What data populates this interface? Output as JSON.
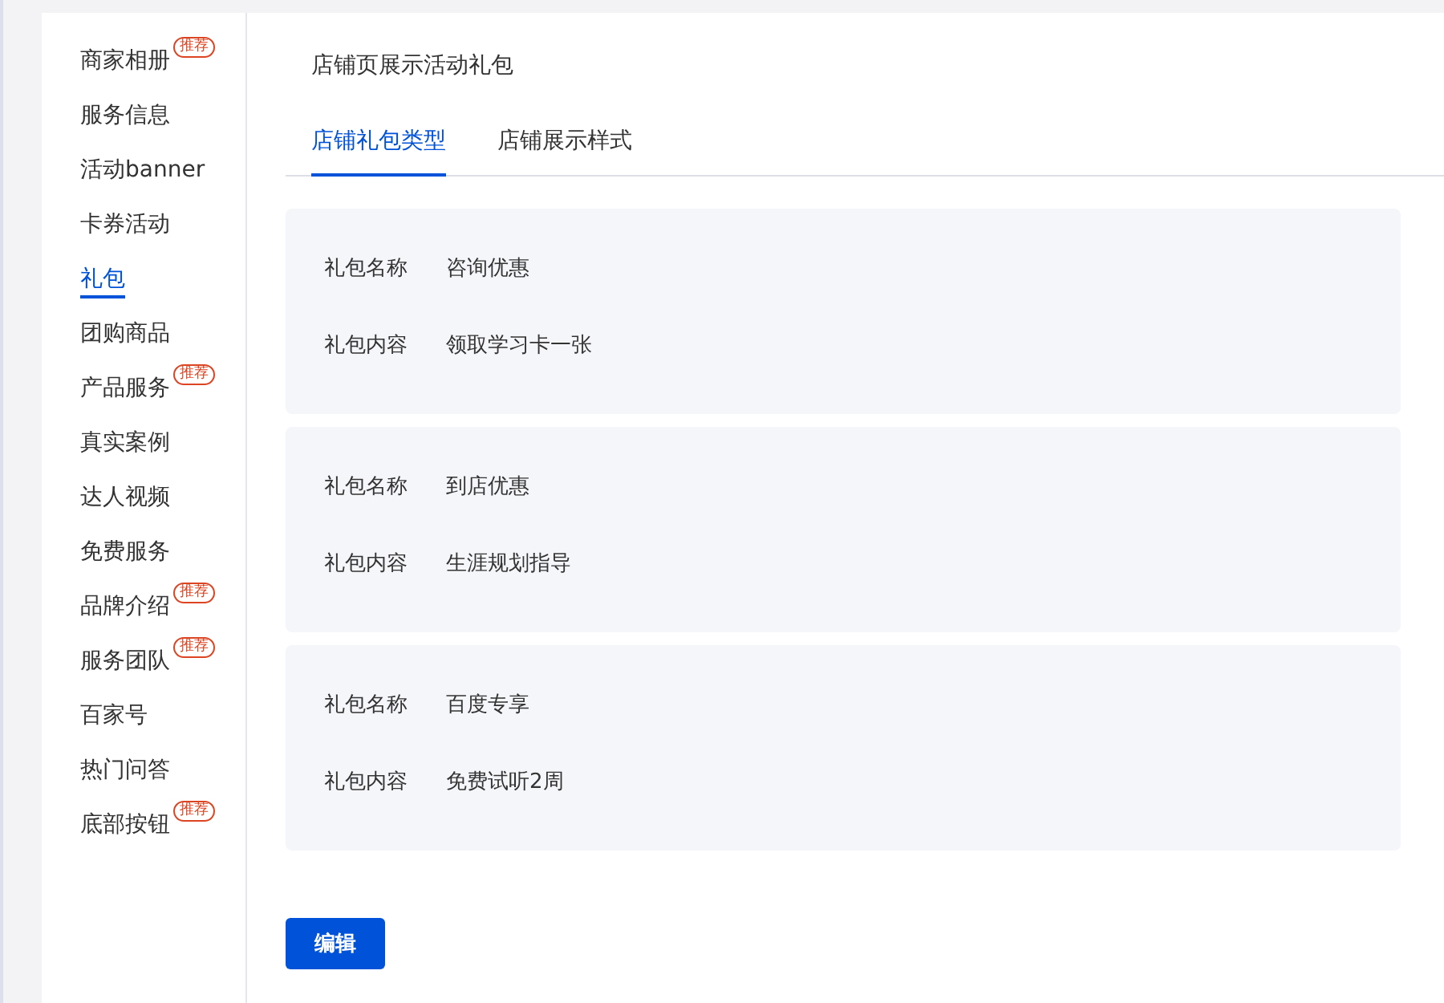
{
  "sidebar": {
    "items": [
      {
        "label": "商家相册",
        "selected": false,
        "badge": "推荐"
      },
      {
        "label": "服务信息",
        "selected": false
      },
      {
        "label": "活动banner",
        "selected": false
      },
      {
        "label": "卡券活动",
        "selected": false
      },
      {
        "label": "礼包",
        "selected": true
      },
      {
        "label": "团购商品",
        "selected": false
      },
      {
        "label": "产品服务",
        "selected": false,
        "badge": "推荐"
      },
      {
        "label": "真实案例",
        "selected": false
      },
      {
        "label": "达人视频",
        "selected": false
      },
      {
        "label": "免费服务",
        "selected": false
      },
      {
        "label": "品牌介绍",
        "selected": false,
        "badge": "推荐"
      },
      {
        "label": "服务团队",
        "selected": false,
        "badge": "推荐"
      },
      {
        "label": "百家号",
        "selected": false
      },
      {
        "label": "热门问答",
        "selected": false
      },
      {
        "label": "底部按钮",
        "selected": false,
        "badge": "推荐"
      }
    ]
  },
  "title": "店铺页展示活动礼包",
  "tabs": [
    {
      "label": "店铺礼包类型",
      "selected": true
    },
    {
      "label": "店铺展示样式",
      "selected": false
    }
  ],
  "gifts": [
    {
      "fields": [
        {
          "label": "礼包名称",
          "value": "咨询优惠"
        },
        {
          "label": "礼包内容",
          "value": "领取学习卡一张"
        }
      ]
    },
    {
      "fields": [
        {
          "label": "礼包名称",
          "value": "到店优惠"
        },
        {
          "label": "礼包内容",
          "value": "生涯规划指导"
        }
      ]
    },
    {
      "fields": [
        {
          "label": "礼包名称",
          "value": "百度专享"
        },
        {
          "label": "礼包内容",
          "value": "免费试听2周"
        }
      ]
    }
  ],
  "edit_button": "编辑"
}
